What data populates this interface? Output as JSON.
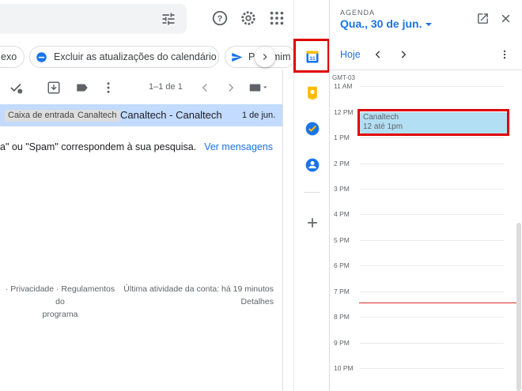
{
  "gmail": {
    "chips": [
      {
        "label": "exo"
      },
      {
        "label": "Excluir as atualizações do calendário"
      },
      {
        "label": "Para mim"
      }
    ],
    "pagination": "1–1 de 1",
    "email_row": {
      "labels": [
        "Caixa de entrada",
        "Canaltech"
      ],
      "subject": "Canaltech - Canaltech",
      "date": "1 de jun."
    },
    "message": {
      "text": "a\" ou \"Spam\" correspondem à sua pesquisa.",
      "link": "Ver mensagens"
    },
    "footer": {
      "policies_line1": "· Privacidade · Regulamentos do",
      "policies_line2": "programa",
      "activity_line1": "Última atividade da conta: há 19 minutos",
      "activity_line2": "Detalhes"
    }
  },
  "calendar": {
    "section": "AGENDA",
    "date": "Qua., 30 de jun.",
    "today": "Hoje",
    "timezone": "GMT-03",
    "hours": [
      "11 AM",
      "12 PM",
      "1 PM",
      "2 PM",
      "3 PM",
      "4 PM",
      "5 PM",
      "6 PM",
      "7 PM",
      "8 PM",
      "9 PM",
      "10 PM"
    ],
    "event": {
      "title": "Canaltech",
      "time": "12 até 1pm"
    }
  },
  "colors": {
    "accent": "#1a73e8",
    "selected_row": "#c2dbff",
    "event_bg": "#b3dff4",
    "highlight_box": "#e00000",
    "now_line": "#d93025"
  }
}
